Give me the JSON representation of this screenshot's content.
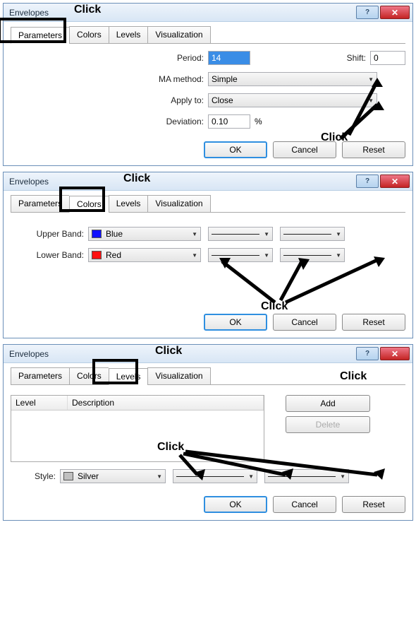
{
  "dialog1": {
    "title": "Envelopes",
    "tabs": [
      "Parameters",
      "Colors",
      "Levels",
      "Visualization"
    ],
    "active_tab": 0,
    "labels": {
      "period": "Period:",
      "shift": "Shift:",
      "ma": "MA method:",
      "apply": "Apply to:",
      "dev": "Deviation:"
    },
    "values": {
      "period": "14",
      "shift": "0",
      "ma": "Simple",
      "apply": "Close",
      "dev": "0.10",
      "pct": "%"
    },
    "buttons": {
      "ok": "OK",
      "cancel": "Cancel",
      "reset": "Reset"
    },
    "annot": {
      "tab": "Click",
      "dd": "Click"
    }
  },
  "dialog2": {
    "title": "Envelopes",
    "tabs": [
      "Parameters",
      "Colors",
      "Levels",
      "Visualization"
    ],
    "active_tab": 1,
    "labels": {
      "upper": "Upper Band:",
      "lower": "Lower Band:"
    },
    "values": {
      "upper": "Blue",
      "lower": "Red"
    },
    "buttons": {
      "ok": "OK",
      "cancel": "Cancel",
      "reset": "Reset"
    },
    "annot": {
      "tab": "Click",
      "dd": "Click"
    }
  },
  "dialog3": {
    "title": "Envelopes",
    "tabs": [
      "Parameters",
      "Colors",
      "Levels",
      "Visualization"
    ],
    "active_tab": 2,
    "list": {
      "headers": [
        "Level",
        "Description"
      ]
    },
    "labels": {
      "style": "Style:"
    },
    "values": {
      "style": "Silver"
    },
    "buttons": {
      "ok": "OK",
      "cancel": "Cancel",
      "reset": "Reset",
      "add": "Add",
      "delete": "Delete"
    },
    "annot": {
      "tab": "Click",
      "add": "Click",
      "dd": "Click"
    }
  }
}
